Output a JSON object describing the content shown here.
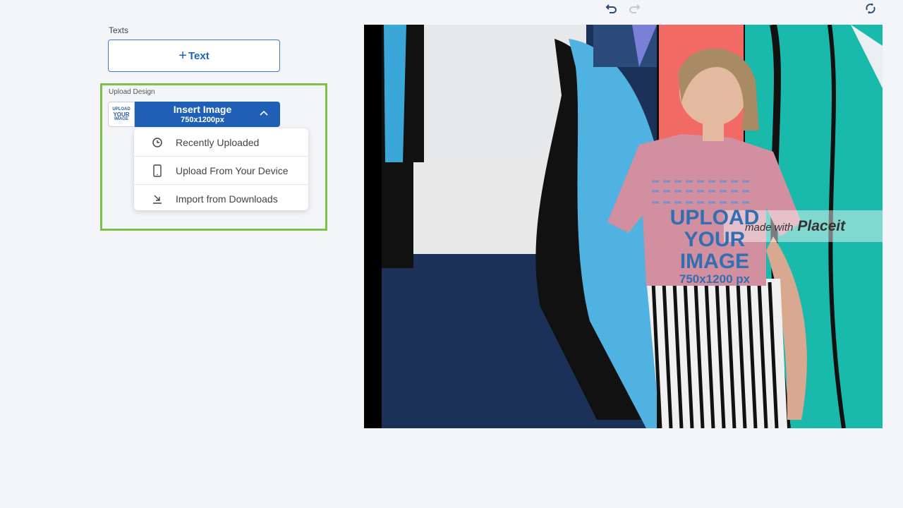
{
  "toolbar": {
    "undo_icon": "undo-icon",
    "redo_icon": "redo-icon",
    "refresh_icon": "refresh-icon"
  },
  "texts": {
    "label": "Texts",
    "add_text_plus": "+",
    "add_text_label": "Text"
  },
  "upload": {
    "label": "Upload Design",
    "thumb_lines": [
      "UPLOAD",
      "YOUR",
      "IMAGE"
    ],
    "insert_label": "Insert Image",
    "insert_size": "750x1200px",
    "menu": [
      {
        "icon": "clock-icon",
        "label": "Recently Uploaded"
      },
      {
        "icon": "phone-icon",
        "label": "Upload From Your Device"
      },
      {
        "icon": "download-icon",
        "label": "Import from Downloads"
      }
    ]
  },
  "preview": {
    "shirt_lines": [
      "UPLOAD",
      "YOUR",
      "IMAGE"
    ],
    "shirt_size": "750x1200 px",
    "watermark_prefix": "made with",
    "watermark_brand": "Placeit",
    "colors": {
      "accent": "#1f5fb5",
      "highlight": "#7ac14a",
      "shirt": "#d28fa0"
    }
  }
}
